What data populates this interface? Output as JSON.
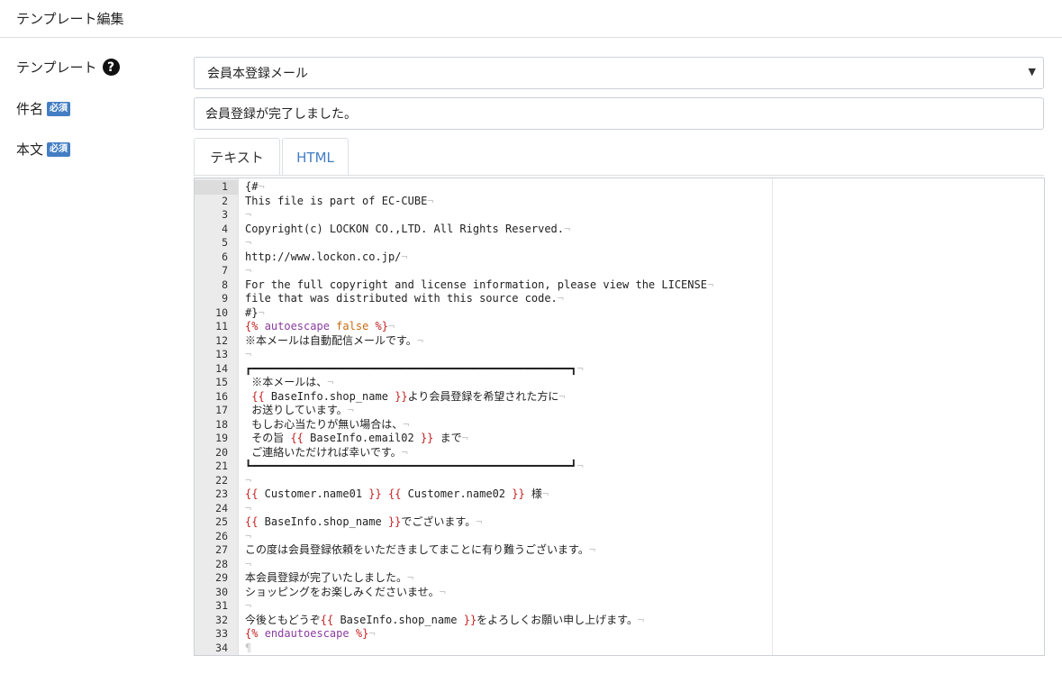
{
  "header": {
    "title": "テンプレート編集"
  },
  "form": {
    "template_label": "テンプレート",
    "template_value": "会員本登録メール",
    "subject_label": "件名",
    "subject_value": "会員登録が完了しました。",
    "body_label": "本文",
    "required_badge": "必須",
    "help_icon_glyph": "?",
    "select_arrow": "▼"
  },
  "tabs": [
    {
      "label": "テキスト",
      "active": true
    },
    {
      "label": "HTML",
      "active": false
    }
  ],
  "editor": {
    "lines": [
      "{#",
      "This file is part of EC-CUBE",
      "",
      "Copyright(c) LOCKON CO.,LTD. All Rights Reserved.",
      "",
      "http://www.lockon.co.jp/",
      "",
      "For the full copyright and license information, please view the LICENSE",
      "file that was distributed with this source code.",
      "#}",
      "{% autoescape false %}",
      "※本メールは自動配信メールです。",
      "",
      "┏━━━━━━━━━━━━━━━━━━━━━━━━━━━━━━━━━━━━━━━━━━━━━━━━━┓",
      " ※本メールは、",
      " {{ BaseInfo.shop_name }}より会員登録を希望された方に",
      " お送りしています。",
      " もしお心当たりが無い場合は、",
      " その旨 {{ BaseInfo.email02 }} まで",
      " ご連絡いただければ幸いです。",
      "┗━━━━━━━━━━━━━━━━━━━━━━━━━━━━━━━━━━━━━━━━━━━━━━━━━┛",
      "",
      "{{ Customer.name01 }} {{ Customer.name02 }} 様",
      "",
      "{{ BaseInfo.shop_name }}でございます。",
      "",
      "この度は会員登録依頼をいただきましてまことに有り難うございます。",
      "",
      "本会員登録が完了いたしました。",
      "ショッピングをお楽しみくださいませ。",
      "",
      "今後ともどうぞ{{ BaseInfo.shop_name }}をよろしくお願い申し上げます。",
      "{% endautoescape %}",
      ""
    ]
  }
}
